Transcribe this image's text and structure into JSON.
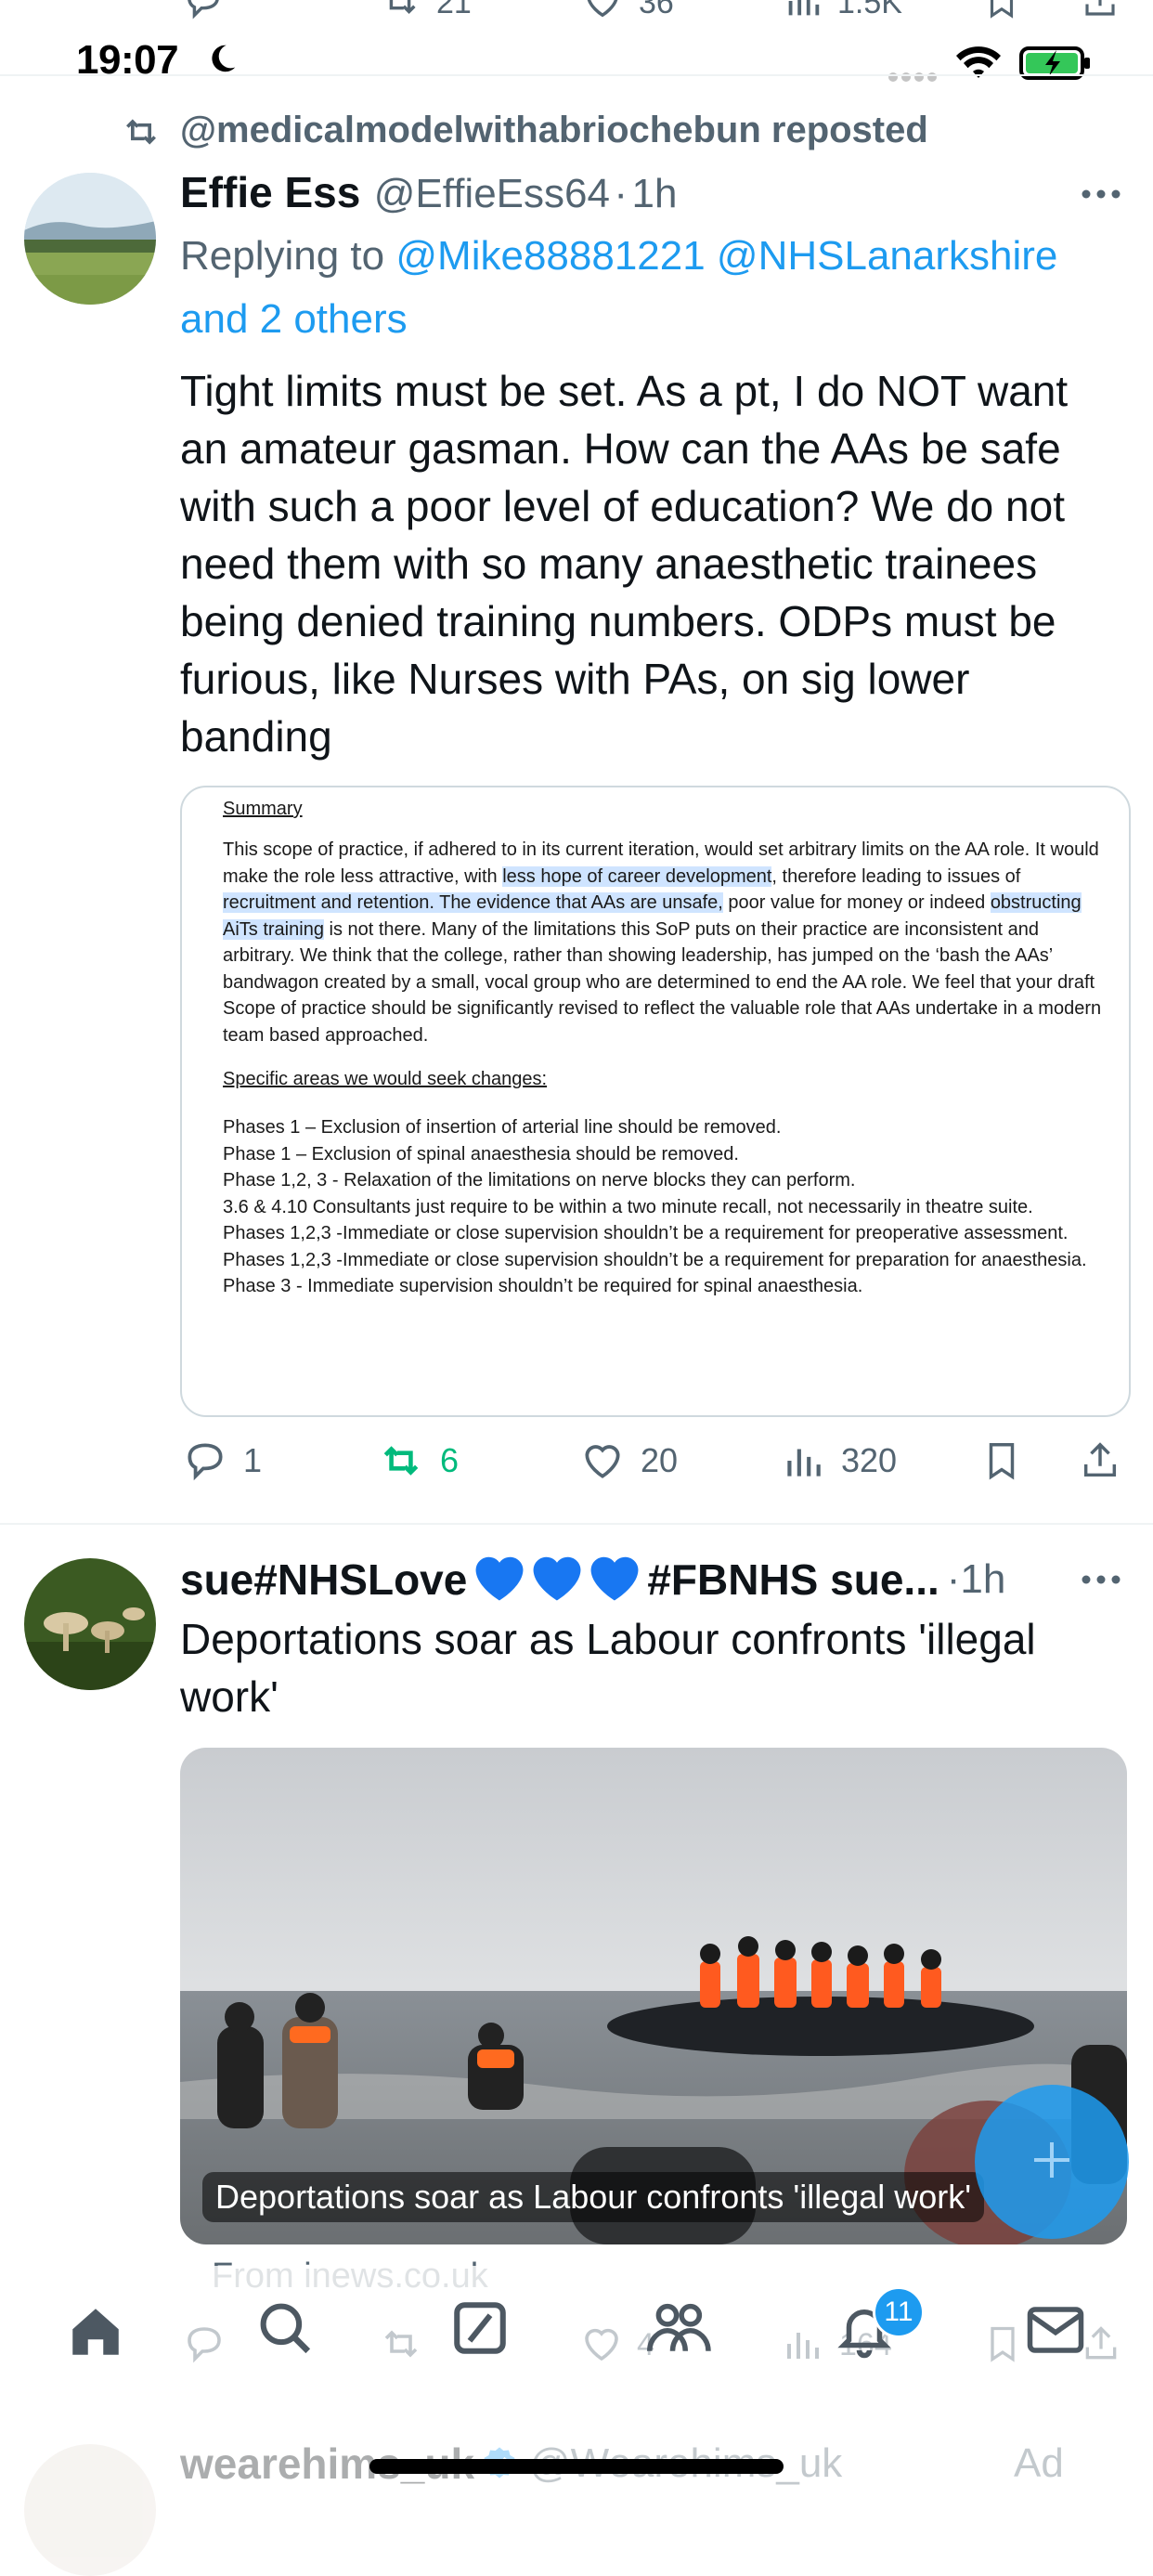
{
  "top_partial_actions": {
    "reposts": "21",
    "likes": "36",
    "views": "1.5K"
  },
  "status_bar": {
    "time": "19:07"
  },
  "tweet1": {
    "repost_label": "@medicalmodelwithabriochebun reposted",
    "name": "Effie Ess",
    "handle": "@EffieEss64",
    "time": "1h",
    "replying_prefix": "Replying to",
    "replying_users": "@Mike88881221 @NHSLanarkshire",
    "replying_others": "and 2 others",
    "text": "Tight limits must be set. As a pt, I do NOT want an amateur gasman. How can the AAs be safe with such a poor level of education? We do not need them with so many anaesthetic trainees being denied training numbers. ODPs must be furious, like Nurses with PAs, on sig lower banding",
    "doc": {
      "summary_heading": "Summary",
      "p1_a": "This scope of practice, if adhered to in its current iteration, would set arbitrary limits on the AA role. It would make the role less attractive, with ",
      "p1_hl1": "less hope of career development",
      "p1_b": ", therefore leading to issues of ",
      "p1_hl2": "recruitment and retention. The evidence that AAs are unsafe,",
      "p1_c": " poor value for money or indeed ",
      "p1_hl3": "obstructing AiTs training",
      "p1_d": " is not there. Many of the limitations this SoP puts on their practice are inconsistent and arbitrary. We think that the college, rather than showing leadership, has jumped on the ‘bash the AAs’ bandwagon created by a small, vocal group who are determined to end the AA role. We feel that your draft Scope of practice should be significantly revised to reflect the valuable role that AAs undertake in a modern team based approached.",
      "areas_heading": "Specific areas we would seek changes:",
      "items": [
        "Phases 1 – Exclusion of insertion of arterial line should be removed.",
        "Phase 1 – Exclusion of spinal anaesthesia should be removed.",
        "Phase 1,2, 3 - Relaxation of the limitations on nerve blocks they can perform.",
        "3.6 & 4.10 Consultants just require to be within a two minute recall, not necessarily in theatre suite.",
        "Phases 1,2,3 -Immediate or close supervision shouldn’t be a requirement for preoperative assessment.",
        "Phases 1,2,3 -Immediate or close supervision shouldn’t be a requirement for preparation for anaesthesia.",
        "Phase 3 - Immediate supervision shouldn’t be required for spinal anaesthesia."
      ]
    },
    "actions": {
      "replies": "1",
      "reposts": "6",
      "likes": "20",
      "views": "320"
    }
  },
  "tweet2": {
    "name": "sue#NHSLove",
    "name_tail": "#FBNHS sue...",
    "time": "1h",
    "text": "Deportations soar as Labour confronts 'illegal work'",
    "image_caption": "Deportations soar as Labour confronts 'illegal work'",
    "source": "From inews.co.uk",
    "actions_partial": {
      "likes": "4",
      "views": "164"
    }
  },
  "tweet3_partial": {
    "name": "wearehims_uk",
    "handle": "@Wearehims_uk",
    "ad_label": "Ad"
  },
  "nav": {
    "notifications_badge": "11"
  },
  "colors": {
    "accent": "#1d9bf0",
    "repost_active": "#00ba7c",
    "text": "#0f1419",
    "muted": "#536471"
  }
}
